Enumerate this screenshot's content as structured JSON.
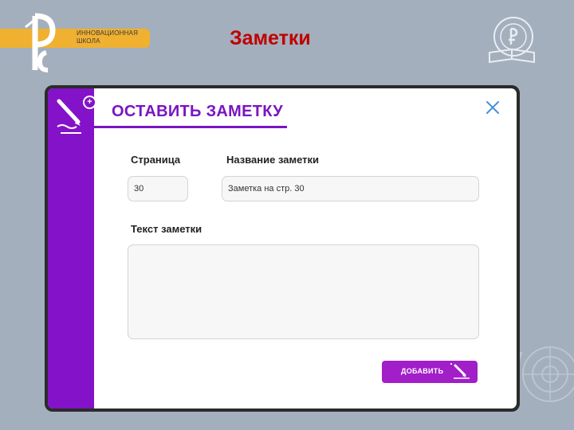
{
  "header": {
    "school_name_line1": "ИННОВАЦИОННАЯ",
    "school_name_line2": "ШКОЛА",
    "title": "Заметки"
  },
  "dialog": {
    "title": "ОСТАВИТЬ ЗАМЕТКУ",
    "page_label": "Страница",
    "page_value": "30",
    "note_name_label": "Название заметки",
    "note_name_value": "Заметка на стр. 30",
    "note_text_label": "Текст заметки",
    "note_text_value": "",
    "add_button_label": "ДОБАВИТЬ"
  },
  "colors": {
    "background": "#a3afbd",
    "accent_purple": "#8412c9",
    "title_red": "#c00000",
    "logo_orange": "#f0b030"
  },
  "icons": {
    "logo": "school-logo-icon",
    "emblem": "book-emblem-icon",
    "sidebar": "pen-writing-icon",
    "close": "close-icon",
    "add": "pen-plus-icon",
    "watermark": "un-emblem-icon"
  }
}
